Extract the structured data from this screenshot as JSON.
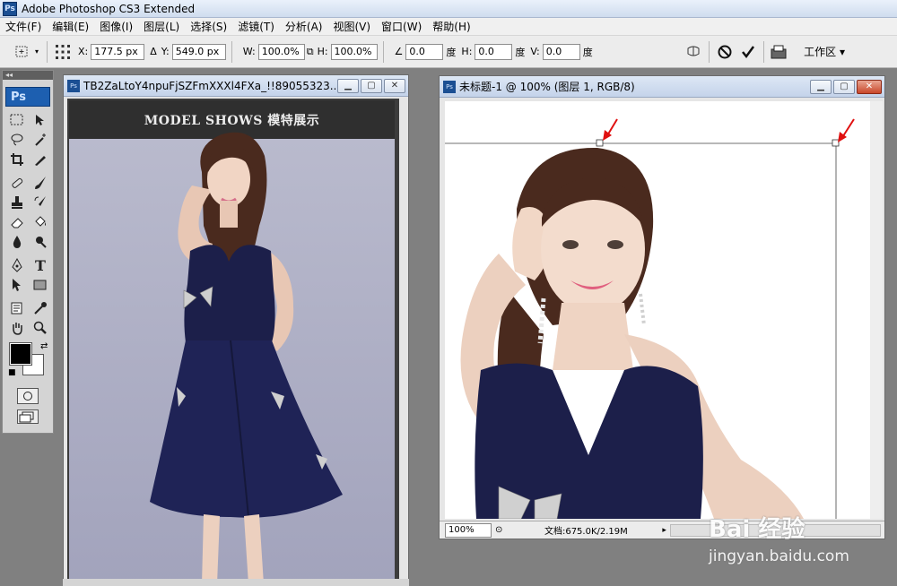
{
  "app": {
    "icon": "Ps",
    "title": "Adobe Photoshop CS3 Extended"
  },
  "menu": [
    "文件(F)",
    "编辑(E)",
    "图像(I)",
    "图层(L)",
    "选择(S)",
    "滤镜(T)",
    "分析(A)",
    "视图(V)",
    "窗口(W)",
    "帮助(H)"
  ],
  "options": {
    "x_label": "X:",
    "x_value": "177.5 px",
    "y_label": "Y:",
    "y_value": "549.0 px",
    "w_label": "W:",
    "w_value": "100.0%",
    "h_label": "H:",
    "h_value": "100.0%",
    "angle_value": "0.0",
    "angle_unit": "度",
    "hskew_label": "H:",
    "hskew_value": "0.0",
    "hskew_unit": "度",
    "vskew_label": "V:",
    "vskew_value": "0.0",
    "vskew_unit": "度",
    "workspace_label": "工作区 ▾"
  },
  "toolbox": {
    "logo": "Ps"
  },
  "doc_left": {
    "title": "TB2ZaLtoY4npuFjSZFmXXXl4FXa_!!89055323...",
    "banner": "MODEL SHOWS 模特展示"
  },
  "doc_right": {
    "title": "未标题-1 @ 100% (图层 1, RGB/8)",
    "zoom": "100%",
    "status": "文档:675.0K/2.19M"
  },
  "watermark": {
    "logo": "Bai 经验",
    "url": "jingyan.baidu.com"
  },
  "colors": {
    "foreground": "#000000",
    "background": "#ffffff",
    "dress": "#1c1f4a",
    "arrow": "#e01010"
  }
}
